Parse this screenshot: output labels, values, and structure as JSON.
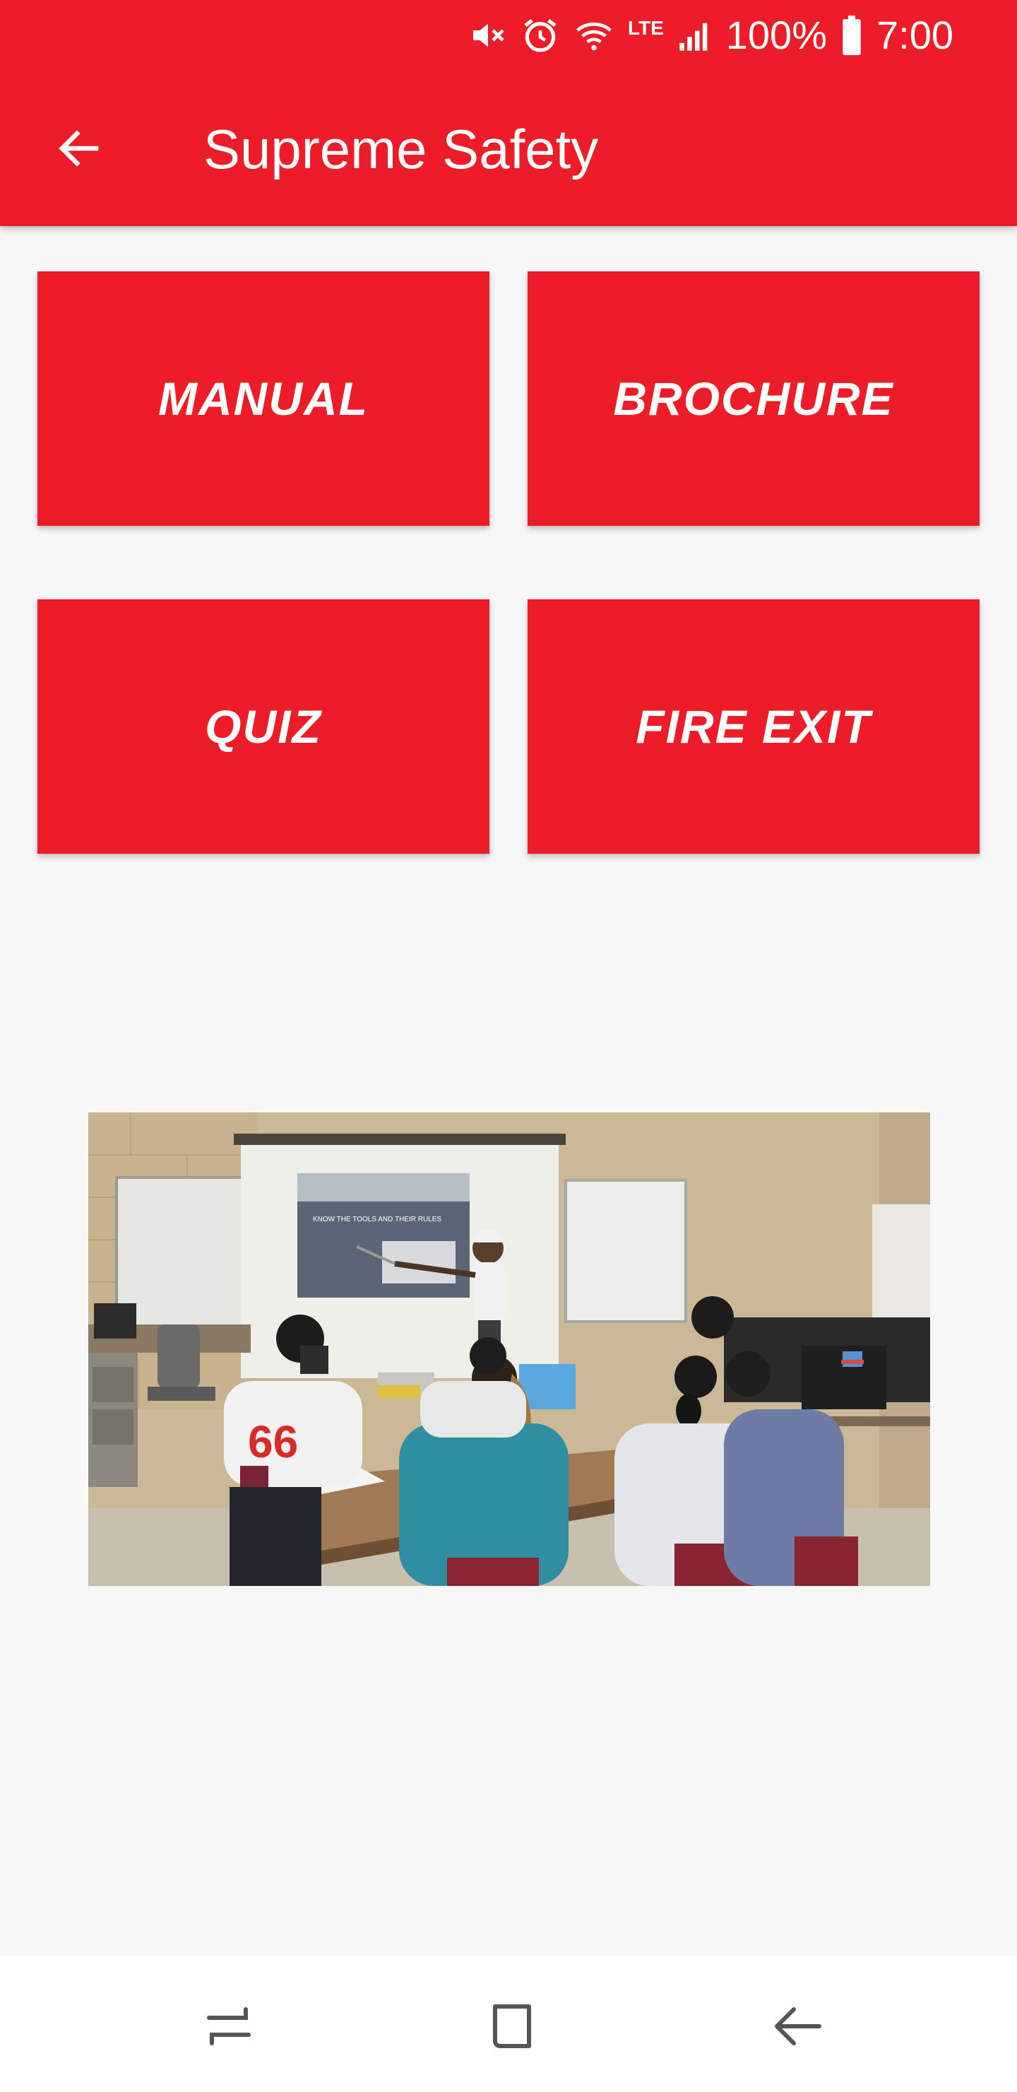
{
  "status_bar": {
    "battery_percent": "100%",
    "time": "7:00",
    "network_label": "LTE",
    "icons": [
      "mute-icon",
      "alarm-icon",
      "wifi-icon",
      "lte-icon",
      "signal-icon",
      "battery-icon"
    ]
  },
  "app_bar": {
    "title": "Supreme Safety",
    "back_icon": "arrow-left-icon",
    "background": "#ec1c28"
  },
  "tiles": [
    {
      "label": "MANUAL"
    },
    {
      "label": "BROCHURE"
    },
    {
      "label": "QUIZ"
    },
    {
      "label": "FIRE EXIT"
    }
  ],
  "photo": {
    "slide_heading": "KNOW THE TOOLS AND THEIR RULES",
    "shirt_number": "66"
  },
  "nav_bar": {
    "items": [
      "recent-apps-icon",
      "home-icon",
      "back-icon"
    ]
  },
  "colors": {
    "accent": "#ec1c28",
    "background": "#f7f7f7",
    "on_accent": "#ffffff"
  }
}
